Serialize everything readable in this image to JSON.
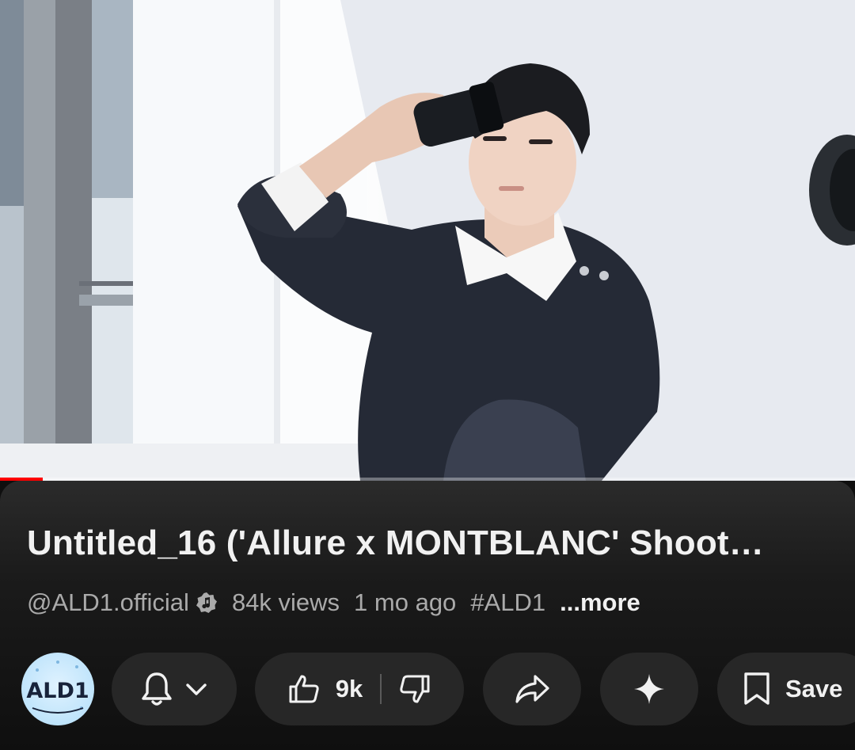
{
  "video": {
    "title": "Untitled_16 ('Allure x MONTBLANC' Shoot…",
    "progress_fraction": 0.05
  },
  "meta": {
    "channel_handle": "@ALD1.official",
    "views": "84k views",
    "age": "1 mo ago",
    "hashtag": "#ALD1",
    "more_label": "...more"
  },
  "channel_avatar": {
    "text": "ALD1"
  },
  "actions": {
    "like_count": "9k",
    "save_label": "Save"
  },
  "icons": {
    "verified": "music-verified-icon",
    "bell": "bell-icon",
    "chevron": "chevron-down-icon",
    "like": "thumbs-up-icon",
    "dislike": "thumbs-down-icon",
    "share": "share-arrow-icon",
    "remix": "sparkle-icon",
    "save": "bookmark-icon"
  },
  "colors": {
    "background": "#0f0f0f",
    "pill": "#272727",
    "text_primary": "#f1f1f1",
    "text_secondary": "#aaaaaa",
    "progress": "#ff0000"
  }
}
